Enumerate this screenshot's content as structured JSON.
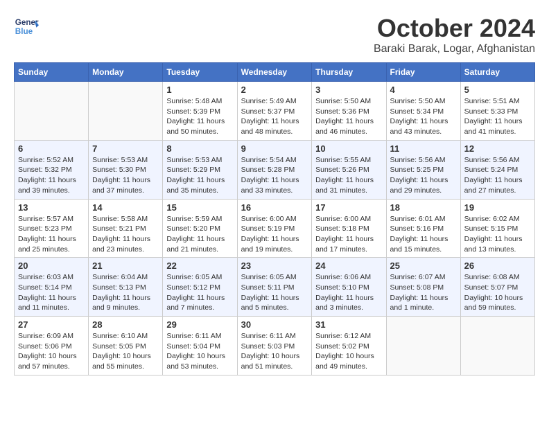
{
  "header": {
    "logo_line1": "General",
    "logo_line2": "Blue",
    "month": "October 2024",
    "location": "Baraki Barak, Logar, Afghanistan"
  },
  "weekdays": [
    "Sunday",
    "Monday",
    "Tuesday",
    "Wednesday",
    "Thursday",
    "Friday",
    "Saturday"
  ],
  "weeks": [
    [
      {
        "day": "",
        "info": ""
      },
      {
        "day": "",
        "info": ""
      },
      {
        "day": "1",
        "info": "Sunrise: 5:48 AM\nSunset: 5:39 PM\nDaylight: 11 hours and 50 minutes."
      },
      {
        "day": "2",
        "info": "Sunrise: 5:49 AM\nSunset: 5:37 PM\nDaylight: 11 hours and 48 minutes."
      },
      {
        "day": "3",
        "info": "Sunrise: 5:50 AM\nSunset: 5:36 PM\nDaylight: 11 hours and 46 minutes."
      },
      {
        "day": "4",
        "info": "Sunrise: 5:50 AM\nSunset: 5:34 PM\nDaylight: 11 hours and 43 minutes."
      },
      {
        "day": "5",
        "info": "Sunrise: 5:51 AM\nSunset: 5:33 PM\nDaylight: 11 hours and 41 minutes."
      }
    ],
    [
      {
        "day": "6",
        "info": "Sunrise: 5:52 AM\nSunset: 5:32 PM\nDaylight: 11 hours and 39 minutes."
      },
      {
        "day": "7",
        "info": "Sunrise: 5:53 AM\nSunset: 5:30 PM\nDaylight: 11 hours and 37 minutes."
      },
      {
        "day": "8",
        "info": "Sunrise: 5:53 AM\nSunset: 5:29 PM\nDaylight: 11 hours and 35 minutes."
      },
      {
        "day": "9",
        "info": "Sunrise: 5:54 AM\nSunset: 5:28 PM\nDaylight: 11 hours and 33 minutes."
      },
      {
        "day": "10",
        "info": "Sunrise: 5:55 AM\nSunset: 5:26 PM\nDaylight: 11 hours and 31 minutes."
      },
      {
        "day": "11",
        "info": "Sunrise: 5:56 AM\nSunset: 5:25 PM\nDaylight: 11 hours and 29 minutes."
      },
      {
        "day": "12",
        "info": "Sunrise: 5:56 AM\nSunset: 5:24 PM\nDaylight: 11 hours and 27 minutes."
      }
    ],
    [
      {
        "day": "13",
        "info": "Sunrise: 5:57 AM\nSunset: 5:23 PM\nDaylight: 11 hours and 25 minutes."
      },
      {
        "day": "14",
        "info": "Sunrise: 5:58 AM\nSunset: 5:21 PM\nDaylight: 11 hours and 23 minutes."
      },
      {
        "day": "15",
        "info": "Sunrise: 5:59 AM\nSunset: 5:20 PM\nDaylight: 11 hours and 21 minutes."
      },
      {
        "day": "16",
        "info": "Sunrise: 6:00 AM\nSunset: 5:19 PM\nDaylight: 11 hours and 19 minutes."
      },
      {
        "day": "17",
        "info": "Sunrise: 6:00 AM\nSunset: 5:18 PM\nDaylight: 11 hours and 17 minutes."
      },
      {
        "day": "18",
        "info": "Sunrise: 6:01 AM\nSunset: 5:16 PM\nDaylight: 11 hours and 15 minutes."
      },
      {
        "day": "19",
        "info": "Sunrise: 6:02 AM\nSunset: 5:15 PM\nDaylight: 11 hours and 13 minutes."
      }
    ],
    [
      {
        "day": "20",
        "info": "Sunrise: 6:03 AM\nSunset: 5:14 PM\nDaylight: 11 hours and 11 minutes."
      },
      {
        "day": "21",
        "info": "Sunrise: 6:04 AM\nSunset: 5:13 PM\nDaylight: 11 hours and 9 minutes."
      },
      {
        "day": "22",
        "info": "Sunrise: 6:05 AM\nSunset: 5:12 PM\nDaylight: 11 hours and 7 minutes."
      },
      {
        "day": "23",
        "info": "Sunrise: 6:05 AM\nSunset: 5:11 PM\nDaylight: 11 hours and 5 minutes."
      },
      {
        "day": "24",
        "info": "Sunrise: 6:06 AM\nSunset: 5:10 PM\nDaylight: 11 hours and 3 minutes."
      },
      {
        "day": "25",
        "info": "Sunrise: 6:07 AM\nSunset: 5:08 PM\nDaylight: 11 hours and 1 minute."
      },
      {
        "day": "26",
        "info": "Sunrise: 6:08 AM\nSunset: 5:07 PM\nDaylight: 10 hours and 59 minutes."
      }
    ],
    [
      {
        "day": "27",
        "info": "Sunrise: 6:09 AM\nSunset: 5:06 PM\nDaylight: 10 hours and 57 minutes."
      },
      {
        "day": "28",
        "info": "Sunrise: 6:10 AM\nSunset: 5:05 PM\nDaylight: 10 hours and 55 minutes."
      },
      {
        "day": "29",
        "info": "Sunrise: 6:11 AM\nSunset: 5:04 PM\nDaylight: 10 hours and 53 minutes."
      },
      {
        "day": "30",
        "info": "Sunrise: 6:11 AM\nSunset: 5:03 PM\nDaylight: 10 hours and 51 minutes."
      },
      {
        "day": "31",
        "info": "Sunrise: 6:12 AM\nSunset: 5:02 PM\nDaylight: 10 hours and 49 minutes."
      },
      {
        "day": "",
        "info": ""
      },
      {
        "day": "",
        "info": ""
      }
    ]
  ]
}
